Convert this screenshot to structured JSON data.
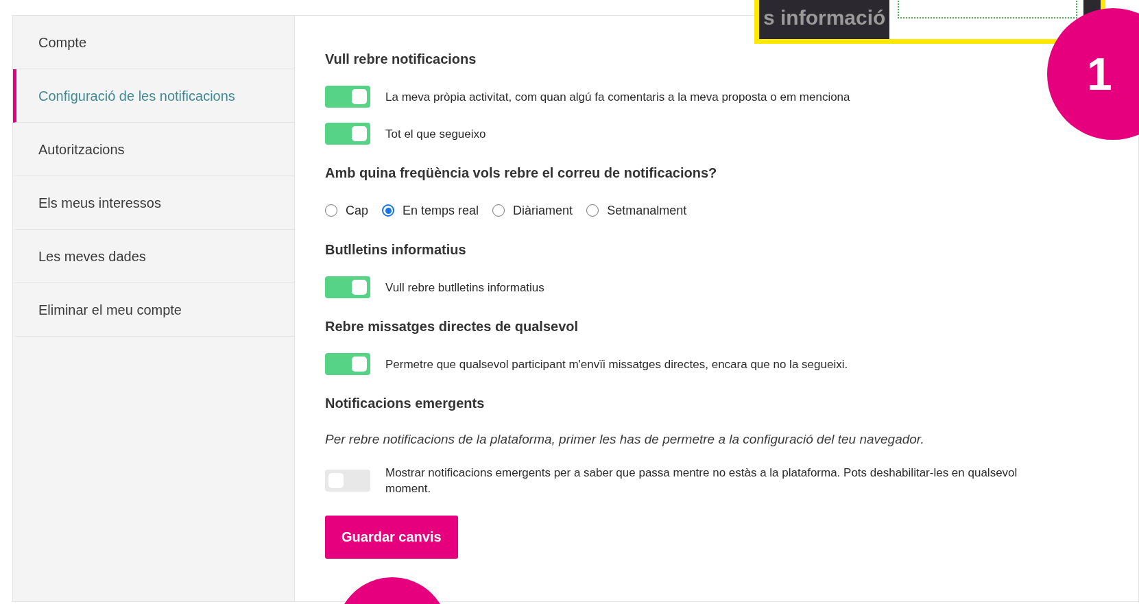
{
  "sidebar": {
    "items": [
      {
        "label": "Compte",
        "selected": false
      },
      {
        "label": "Configuració de les notificacions",
        "selected": true
      },
      {
        "label": "Autoritzacions",
        "selected": false
      },
      {
        "label": "Els meus interessos",
        "selected": false
      },
      {
        "label": "Les meves dades",
        "selected": false
      },
      {
        "label": "Eliminar el meu compte",
        "selected": false
      }
    ]
  },
  "sections": [
    {
      "title": "Vull rebre notificacions",
      "items": [
        {
          "kind": "toggle",
          "label": "La meva pròpia activitat, com quan algú fa comentaris a la meva proposta o em menciona",
          "on": true
        },
        {
          "kind": "toggle",
          "label": "Tot el que segueixo",
          "on": true
        }
      ]
    },
    {
      "title": "Amb quina freqüència vols rebre el correu de notificacions?",
      "items": [
        {
          "kind": "radios",
          "options": [
            {
              "label": "Cap",
              "selected": false
            },
            {
              "label": "En temps real",
              "selected": true
            },
            {
              "label": "Diàriament",
              "selected": false
            },
            {
              "label": "Setmanalment",
              "selected": false
            }
          ]
        }
      ]
    },
    {
      "title": "Butlletins informatius",
      "items": [
        {
          "kind": "toggle",
          "label": "Vull rebre butlletins informatius",
          "on": true
        }
      ]
    },
    {
      "title": "Rebre missatges directes de qualsevol",
      "items": [
        {
          "kind": "toggle",
          "label": "Permetre que qualsevol participant m'envïi missatges directes, encara que no la segueixi.",
          "on": true
        }
      ]
    },
    {
      "title": "Notificacions emergents",
      "items": [
        {
          "kind": "note",
          "label": "Per rebre notificacions de la plataforma, primer les has de permetre a la configuració del teu navegador."
        },
        {
          "kind": "toggle",
          "label": "Mostrar notificacions emergents per a saber que passa mentre no estàs a la plataforma. Pots deshabilitar-les en qualsevol moment.",
          "on": false
        }
      ]
    }
  ],
  "save_button": "Guardar canvis",
  "callout": {
    "banner_text": "s informació",
    "step_number": "1"
  }
}
